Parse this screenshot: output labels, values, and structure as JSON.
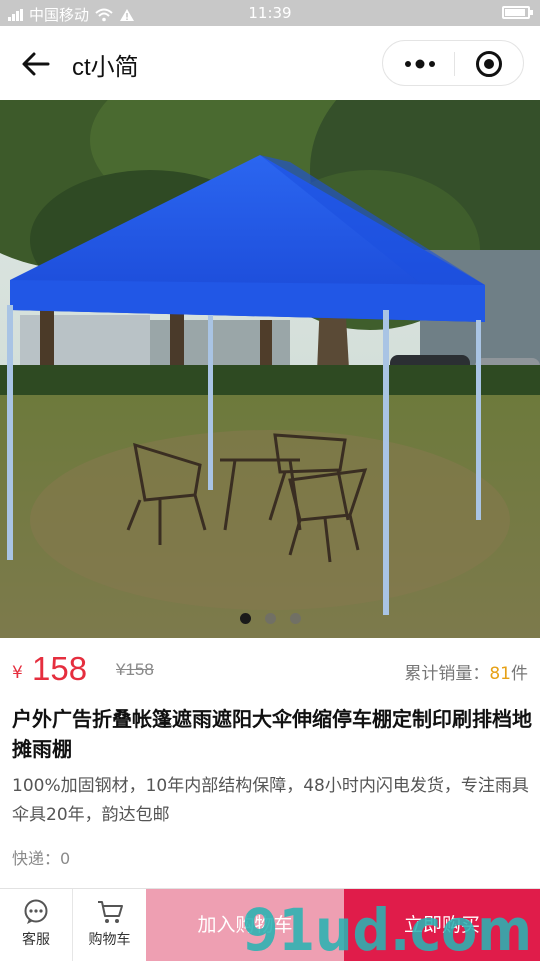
{
  "status_bar": {
    "carrier": "中国移动",
    "time": "11:39",
    "battery_level": 0.9
  },
  "nav": {
    "title": "ct小简",
    "icons": [
      "back-arrow-icon",
      "more-dots-icon",
      "record-icon"
    ]
  },
  "gallery": {
    "image": "blue-folding-canopy-tent-photo",
    "slide_count": 3,
    "active_slide": 1
  },
  "product": {
    "currency_symbol": "¥",
    "price": "158",
    "original_price": "¥158",
    "sales_label": "累计销量：",
    "sales_count": "81",
    "sales_unit": "件",
    "title": "户外广告折叠帐篷遮雨遮阳大伞伸缩停车棚定制印刷排档地摊雨棚",
    "description": "100%加固钢材，10年内部结构保障，48小时内闪电发货，专注雨具伞具20年，韵达包邮",
    "shipping": "快递：0"
  },
  "bottom_bar": {
    "service_label": "客服",
    "cart_label": "购物车",
    "add_to_cart_label": "加入购物车",
    "buy_now_label": "立即购买"
  },
  "watermark": {
    "text": "91ud.com"
  },
  "colors": {
    "price_red": "#e52e3e",
    "sales_count_orange": "#e6a117",
    "add_to_cart_pink": "#ee9fb2",
    "buy_now_red": "#e01c4a",
    "watermark_teal": "#2bb3b3",
    "tent_blue": "#1d4fe0"
  }
}
